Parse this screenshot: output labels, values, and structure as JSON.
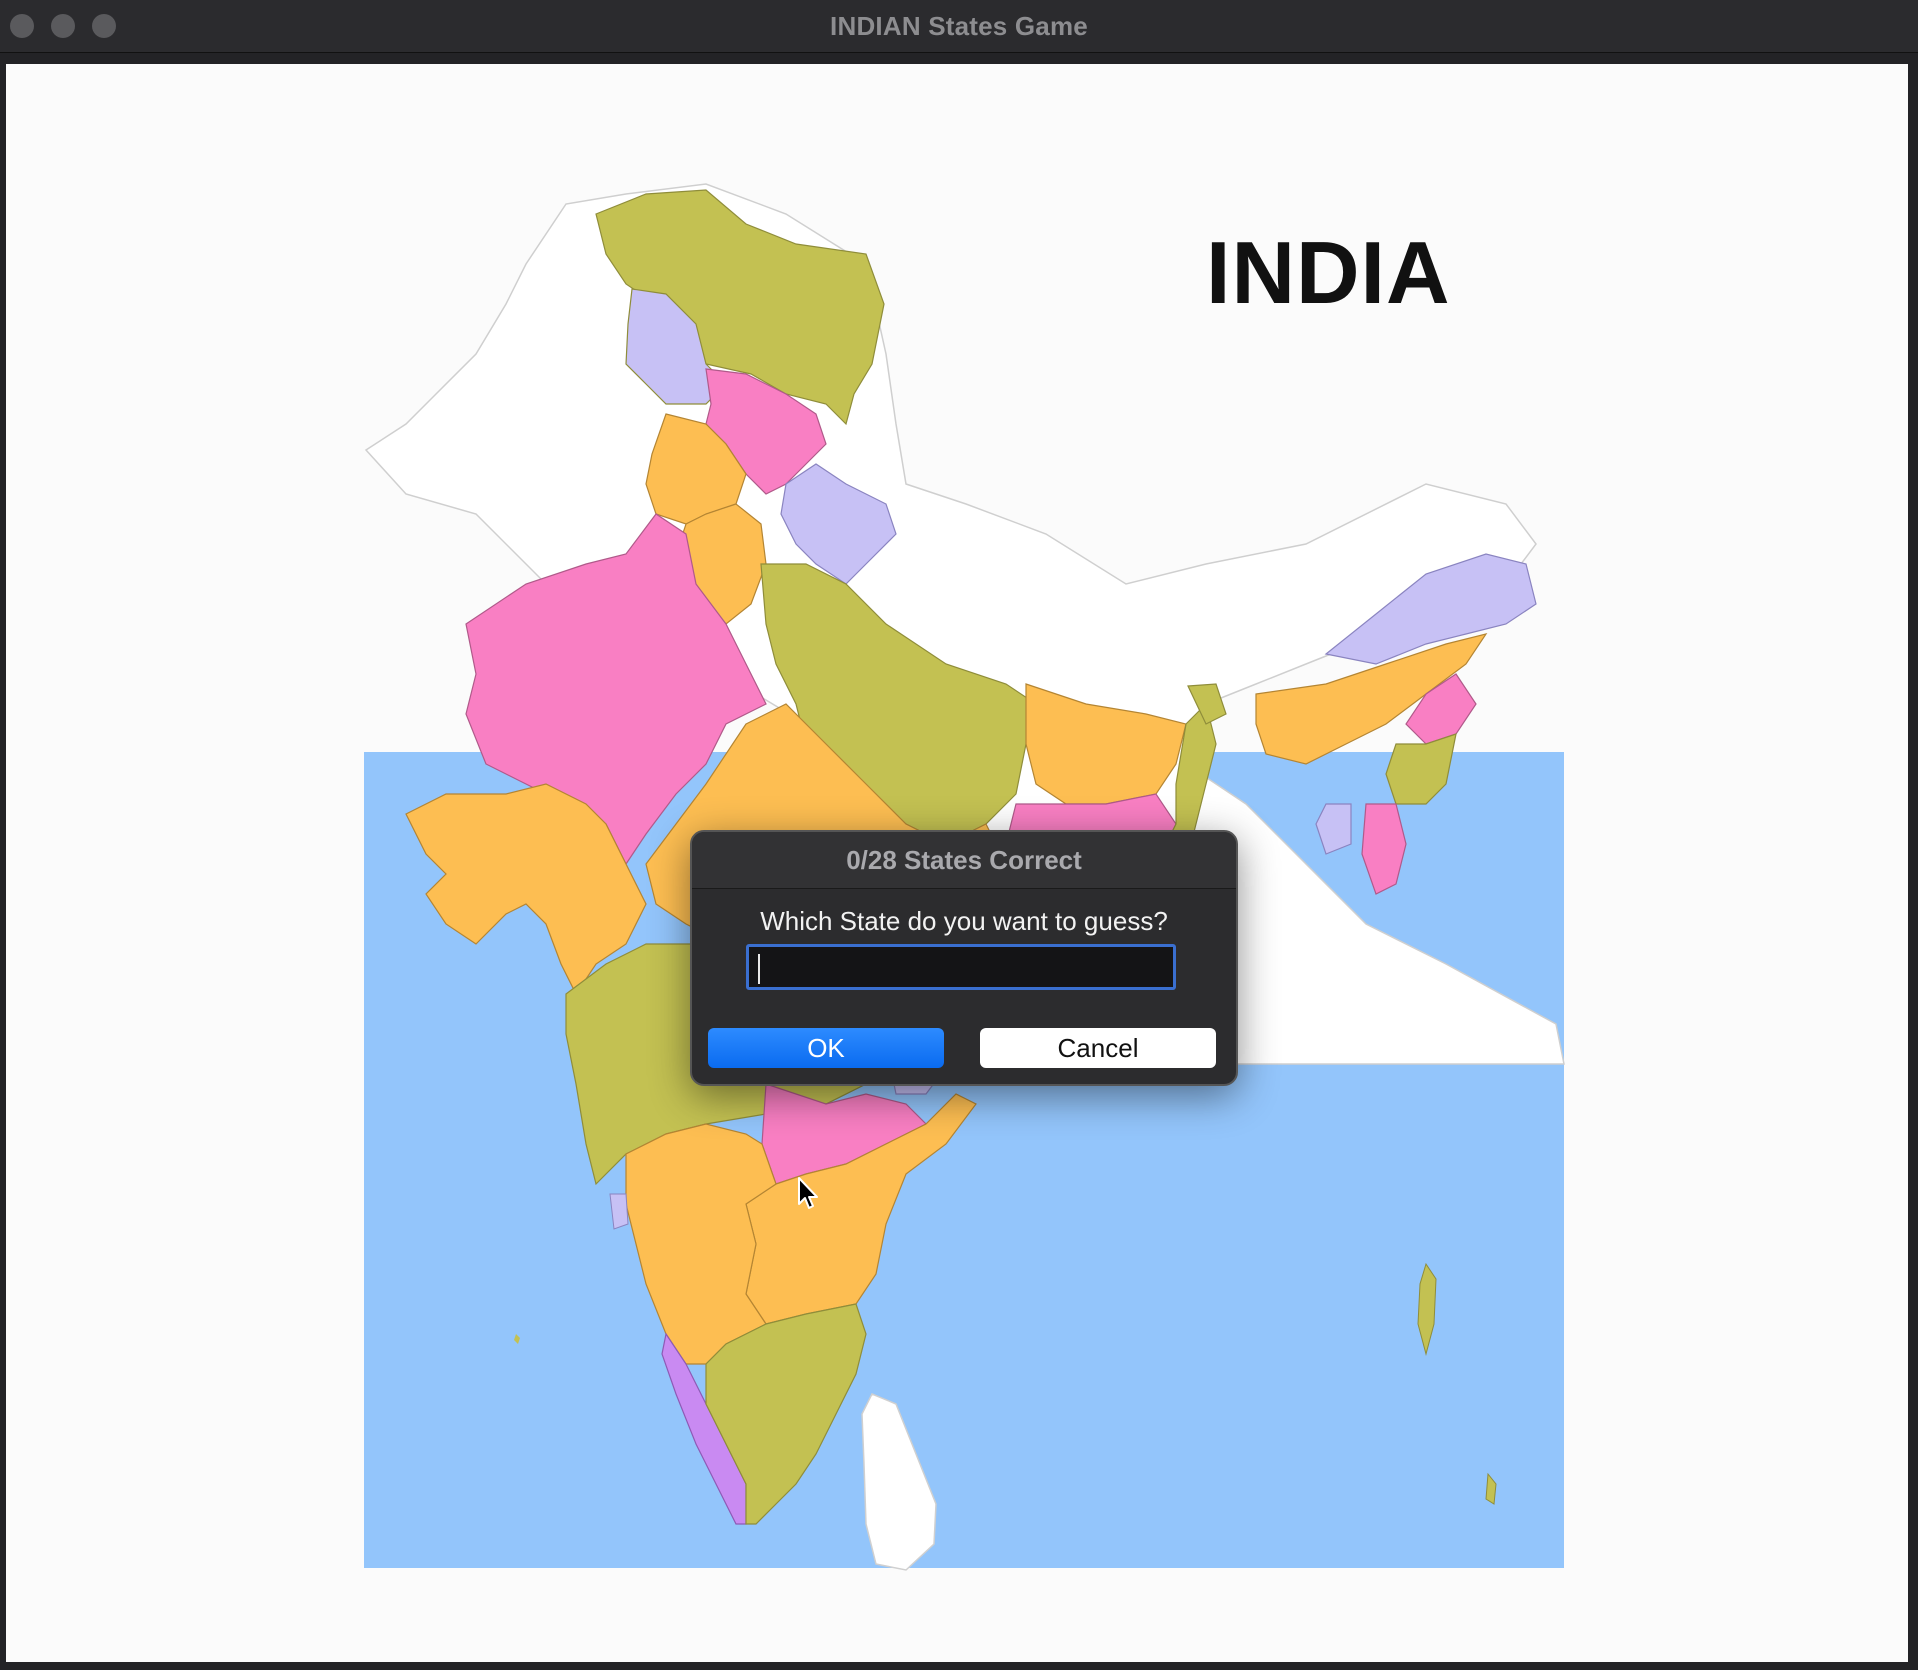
{
  "window": {
    "title": "INDIAN States Game"
  },
  "map": {
    "label": "INDIA",
    "colors": {
      "sea": "#93c5fb",
      "yellow": "#fdbe52",
      "pink": "#f97fc3",
      "olive": "#c3c152",
      "lavender": "#c7c1f5",
      "violet": "#c98af2",
      "land_white": "#ffffff"
    }
  },
  "dialog": {
    "title": "0/28 States Correct",
    "prompt": "Which State do you want to guess?",
    "input_value": "",
    "ok_label": "OK",
    "cancel_label": "Cancel"
  },
  "icons": {
    "cursor": "arrow-pointer-icon"
  }
}
